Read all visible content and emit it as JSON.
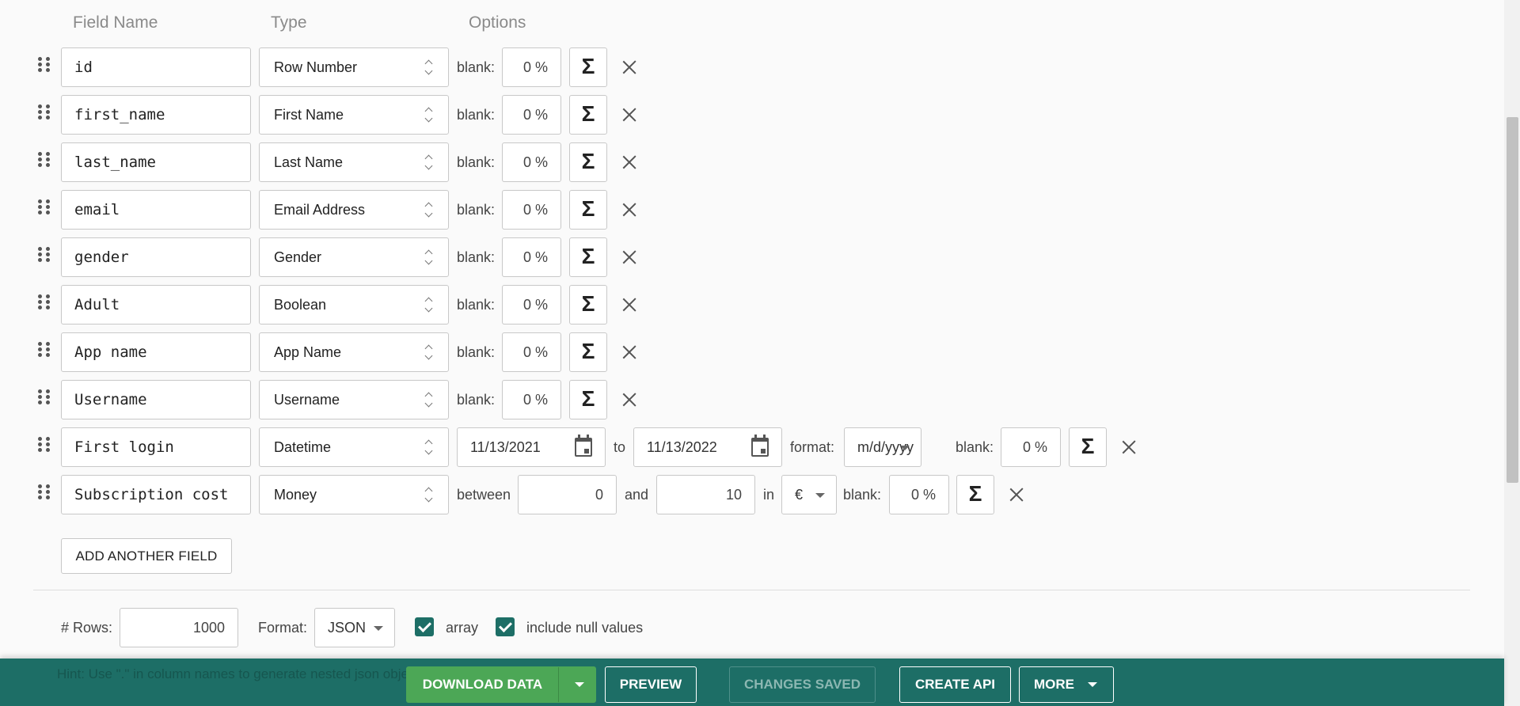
{
  "headers": {
    "field_name": "Field Name",
    "type": "Type",
    "options": "Options"
  },
  "labels": {
    "blank": "blank:",
    "to": "to",
    "format": "format:",
    "between": "between",
    "and": "and",
    "in": "in",
    "sigma": "Σ"
  },
  "fields": [
    {
      "name": "id",
      "type": "Row Number",
      "blank": "0 %"
    },
    {
      "name": "first_name",
      "type": "First Name",
      "blank": "0 %"
    },
    {
      "name": "last_name",
      "type": "Last Name",
      "blank": "0 %"
    },
    {
      "name": "email",
      "type": "Email Address",
      "blank": "0 %"
    },
    {
      "name": "gender",
      "type": "Gender",
      "blank": "0 %"
    },
    {
      "name": "Adult",
      "type": "Boolean",
      "blank": "0 %"
    },
    {
      "name": "App name",
      "type": "App Name",
      "blank": "0 %"
    },
    {
      "name": "Username",
      "type": "Username",
      "blank": "0 %"
    },
    {
      "name": "First login",
      "type": "Datetime",
      "from": "11/13/2021",
      "to": "11/13/2022",
      "format": "m/d/yyyy",
      "blank": "0 %"
    },
    {
      "name": "Subscription cost",
      "type": "Money",
      "min": "0",
      "max": "10",
      "currency": "€",
      "blank": "0 %"
    }
  ],
  "add_field_label": "ADD ANOTHER FIELD",
  "rows": {
    "label": "# Rows:",
    "value": "1000"
  },
  "format": {
    "label": "Format:",
    "value": "JSON"
  },
  "checkboxes": [
    {
      "label": "array",
      "checked": true
    },
    {
      "label": "include null values",
      "checked": true
    }
  ],
  "footer": {
    "hint": "Hint: Use \".\" in column names to generate nested json objects. See Documentation",
    "download_label": "DOWNLOAD DATA",
    "preview_label": "PREVIEW",
    "saved_label": "CHANGES SAVED",
    "create_api_label": "CREATE API",
    "more_label": "MORE"
  },
  "colors": {
    "accent": "#1d6e66",
    "download": "#4ca756"
  }
}
